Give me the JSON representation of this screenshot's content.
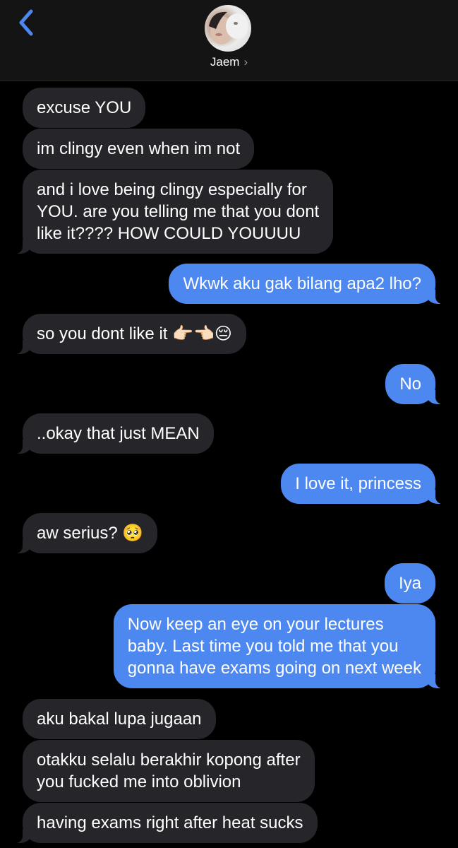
{
  "header": {
    "contact_name": "Jaem",
    "chevron": "›",
    "back_icon": "chevron-left-icon",
    "accent_color": "#4d87f0"
  },
  "messages": [
    {
      "from": "contact",
      "text": "excuse YOU"
    },
    {
      "from": "contact",
      "text": "im clingy even when im not"
    },
    {
      "from": "contact",
      "text": "and i love being clingy especially for\nYOU. are you telling me that you dont\nlike it???? HOW COULD YOUUUU"
    },
    {
      "from": "me",
      "text": "Wkwk aku gak bilang apa2 lho?"
    },
    {
      "from": "contact",
      "text": "so you dont like it 👉🏻👈🏻😔"
    },
    {
      "from": "me",
      "text": "No"
    },
    {
      "from": "contact",
      "text": "..okay that just MEAN"
    },
    {
      "from": "me",
      "text": "I love it, princess"
    },
    {
      "from": "contact",
      "text": "aw serius? 🥺"
    },
    {
      "from": "me",
      "text": "Iya"
    },
    {
      "from": "me",
      "text": "Now keep an eye on your lectures\nbaby. Last time you told me that you\ngonna have exams going on next week"
    },
    {
      "from": "contact",
      "text": "aku bakal lupa jugaan"
    },
    {
      "from": "contact",
      "text": "otakku selalu berakhir kopong after\nyou fucked me into oblivion"
    },
    {
      "from": "contact",
      "text": "having exams right after heat sucks"
    }
  ]
}
